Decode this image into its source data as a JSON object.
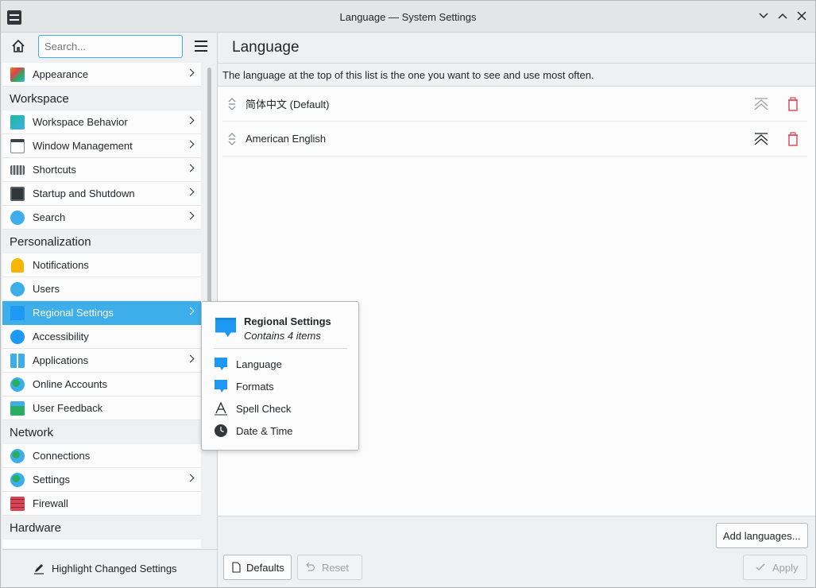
{
  "window": {
    "title": "Language — System Settings"
  },
  "sidebar": {
    "search_placeholder": "Search...",
    "highlight_button": "Highlight Changed Settings",
    "sections": [
      {
        "type": "item",
        "label": "Appearance",
        "icon": "appearance-icon",
        "has_children": true
      },
      {
        "type": "group",
        "label": "Workspace"
      },
      {
        "type": "item",
        "label": "Workspace Behavior",
        "icon": "workspace-behavior-icon",
        "has_children": true
      },
      {
        "type": "item",
        "label": "Window Management",
        "icon": "window-management-icon",
        "has_children": true
      },
      {
        "type": "item",
        "label": "Shortcuts",
        "icon": "keyboard-icon",
        "has_children": true
      },
      {
        "type": "item",
        "label": "Startup and Shutdown",
        "icon": "monitor-icon",
        "has_children": true
      },
      {
        "type": "item",
        "label": "Search",
        "icon": "search-icon",
        "has_children": true
      },
      {
        "type": "group",
        "label": "Personalization"
      },
      {
        "type": "item",
        "label": "Notifications",
        "icon": "bell-icon",
        "has_children": false
      },
      {
        "type": "item",
        "label": "Users",
        "icon": "users-icon",
        "has_children": false
      },
      {
        "type": "item",
        "label": "Regional Settings",
        "icon": "speech-bubble-icon",
        "has_children": true,
        "selected": true
      },
      {
        "type": "item",
        "label": "Accessibility",
        "icon": "accessibility-icon",
        "has_children": false
      },
      {
        "type": "item",
        "label": "Applications",
        "icon": "applications-grid-icon",
        "has_children": true
      },
      {
        "type": "item",
        "label": "Online Accounts",
        "icon": "globe-icon",
        "has_children": false
      },
      {
        "type": "item",
        "label": "User Feedback",
        "icon": "feedback-icon",
        "has_children": false
      },
      {
        "type": "group",
        "label": "Network"
      },
      {
        "type": "item",
        "label": "Connections",
        "icon": "globe-icon",
        "has_children": false
      },
      {
        "type": "item",
        "label": "Settings",
        "icon": "globe-icon",
        "has_children": true
      },
      {
        "type": "item",
        "label": "Firewall",
        "icon": "firewall-icon",
        "has_children": false
      },
      {
        "type": "group",
        "label": "Hardware"
      }
    ]
  },
  "main": {
    "title": "Language",
    "description": "The language at the top of this list is the one you want to see and use most often.",
    "languages": [
      {
        "label": "简体中文 (Default)"
      },
      {
        "label": "American English"
      }
    ],
    "add_languages_button": "Add languages...",
    "defaults_button": "Defaults",
    "reset_button": "Reset",
    "apply_button": "Apply"
  },
  "popup": {
    "title": "Regional Settings",
    "subtitle": "Contains 4 items",
    "items": [
      {
        "label": "Language",
        "icon": "speech-bubble-icon"
      },
      {
        "label": "Formats",
        "icon": "speech-bubble-icon"
      },
      {
        "label": "Spell Check",
        "icon": "spell-check-icon"
      },
      {
        "label": "Date & Time",
        "icon": "clock-icon"
      }
    ]
  },
  "colors": {
    "accent": "#3daee9",
    "delete": "#da4453"
  }
}
